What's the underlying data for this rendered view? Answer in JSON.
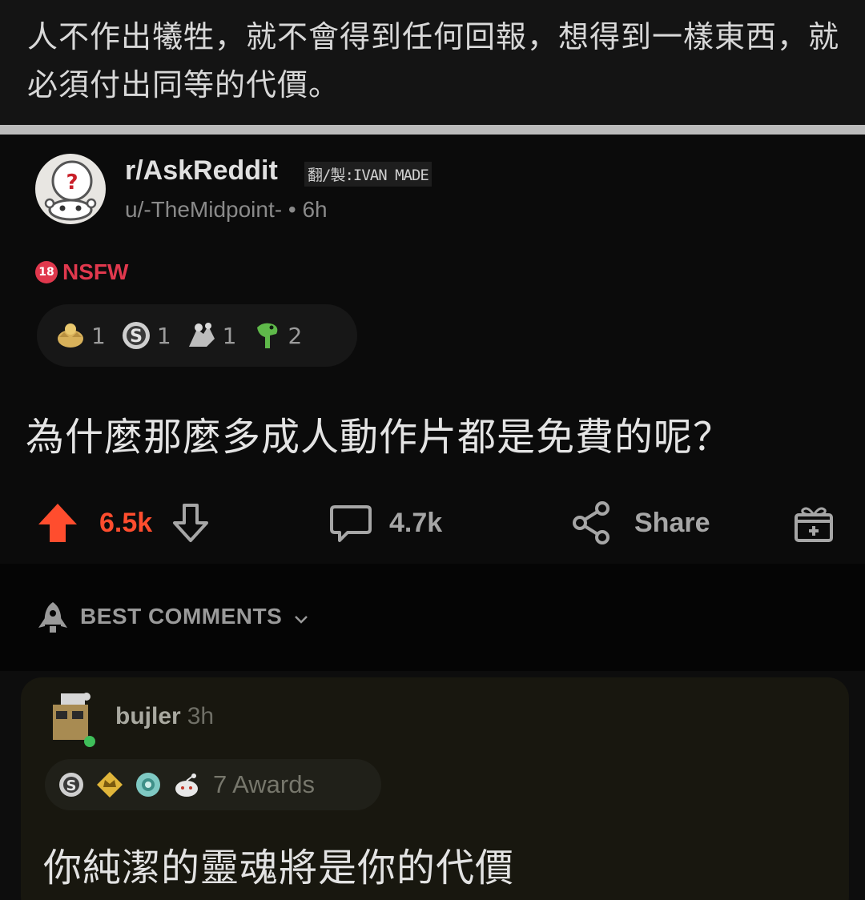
{
  "caption": {
    "text": "人不作出犧牲，就不會得到任何回報，想得到一樣東西，就必須付出同等的代價。"
  },
  "post": {
    "subreddit": "r/AskReddit",
    "watermark": "翻/製:IVAN MADE",
    "author_meta": "u/-TheMidpoint- • 6h",
    "nsfw_badge": "18",
    "nsfw_label": "NSFW",
    "awards": [
      {
        "icon": "gold-hands-award-icon",
        "count": "1"
      },
      {
        "icon": "silver-coin-award-icon",
        "count": "1"
      },
      {
        "icon": "hug-award-icon",
        "count": "1"
      },
      {
        "icon": "dinosaur-award-icon",
        "count": "2"
      }
    ],
    "title": "為什麼那麼多成人動作片都是免費的呢？",
    "upvotes": "6.5k",
    "comments": "4.7k",
    "share_label": "Share"
  },
  "sort": {
    "label": "BEST COMMENTS"
  },
  "comment": {
    "username": "bujler",
    "time": "3h",
    "awards_label": "7 Awards",
    "body": "你純潔的靈魂將是你的代價"
  },
  "colors": {
    "upvote": "#ff4d2e",
    "nsfw": "#e0384d",
    "background": "#0b0b0b",
    "comment_bg": "#18170f"
  }
}
